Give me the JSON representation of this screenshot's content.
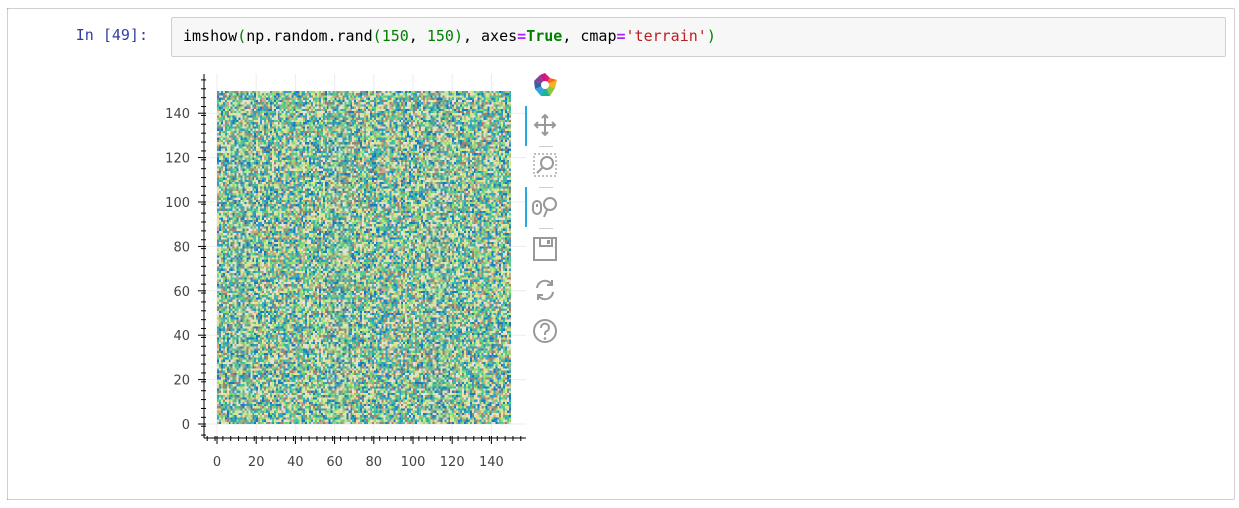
{
  "cell": {
    "prompt": "In [49]:",
    "code": {
      "fn": "imshow",
      "open": "(",
      "arg1_prefix": "np.random.rand",
      "open2": "(",
      "n1": "150",
      "comma1": ", ",
      "n2": "150",
      "close2": ")",
      "comma2": ", ",
      "kw1": "axes",
      "eq1": "=",
      "val1": "True",
      "comma3": ", ",
      "kw2": "cmap",
      "eq2": "=",
      "val2": "'terrain'",
      "close": ")"
    }
  },
  "toolbar": {
    "items": [
      {
        "name": "bokeh-logo-icon",
        "active": false
      },
      {
        "name": "pan-icon",
        "active": true
      },
      {
        "name": "box-zoom-icon",
        "active": false
      },
      {
        "name": "wheel-zoom-icon",
        "active": true
      },
      {
        "name": "save-icon",
        "active": false
      },
      {
        "name": "reset-icon",
        "active": false
      },
      {
        "name": "help-icon",
        "active": false
      }
    ]
  },
  "chart_data": {
    "type": "heatmap",
    "title": "",
    "xlabel": "",
    "ylabel": "",
    "xlim": [
      0,
      150
    ],
    "ylim": [
      0,
      150
    ],
    "xticks": [
      0,
      20,
      40,
      60,
      80,
      100,
      120,
      140
    ],
    "yticks": [
      0,
      20,
      40,
      60,
      80,
      100,
      120,
      140
    ],
    "grid": true,
    "colormap": "terrain",
    "rows": 150,
    "cols": 150,
    "value_range": [
      0,
      1
    ],
    "palette": [
      "#2e9cc4",
      "#1a7abf",
      "#5cc98c",
      "#8fdc79",
      "#c9e88d",
      "#e8dfa0",
      "#c2ac85",
      "#9a8470",
      "#e6e0da",
      "#3fb6a8"
    ]
  }
}
